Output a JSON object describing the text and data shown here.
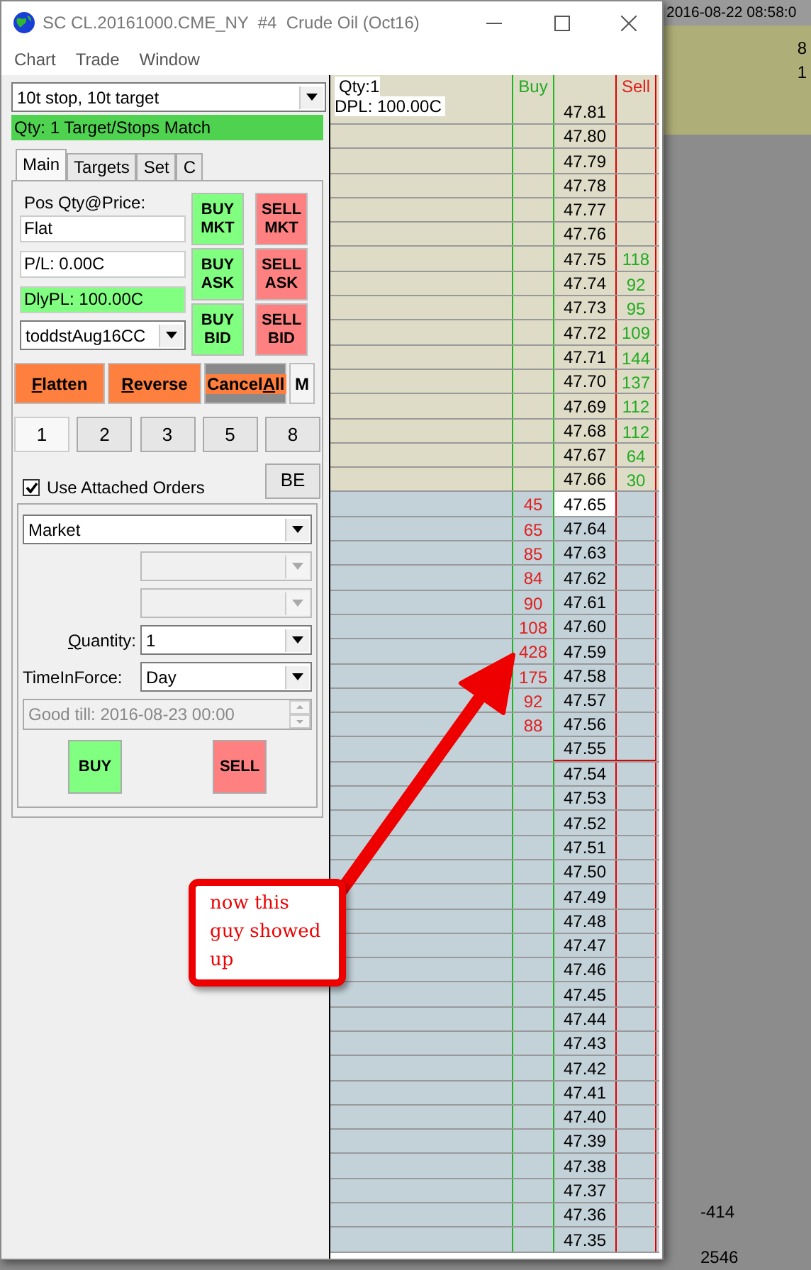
{
  "window": {
    "title": "SC CL.20161000.CME_NY  #4  Crude Oil (Oct16)"
  },
  "menu": [
    "Chart",
    "Trade",
    "Window"
  ],
  "trade_panel": {
    "preset": "10t stop, 10t target",
    "status": "Qty: 1 Target/Stops Match",
    "tabs": [
      {
        "label": "Main",
        "selected": true
      },
      {
        "label": "Targets",
        "selected": false
      },
      {
        "label": "Set",
        "selected": false
      },
      {
        "label": "C",
        "selected": false
      }
    ],
    "pos_label": "Pos Qty@Price:",
    "pos_value": "Flat",
    "pl": "P/L: 0.00C",
    "daily_pl": "DlyPL: 100.00C",
    "account": "toddstAug16CC",
    "order_buttons": [
      {
        "line1": "BUY",
        "line2": "MKT",
        "kind": "buy"
      },
      {
        "line1": "SELL",
        "line2": "MKT",
        "kind": "sell"
      },
      {
        "line1": "BUY",
        "line2": "ASK",
        "kind": "buy"
      },
      {
        "line1": "SELL",
        "line2": "ASK",
        "kind": "sell"
      },
      {
        "line1": "BUY",
        "line2": "BID",
        "kind": "buy"
      },
      {
        "line1": "SELL",
        "line2": "BID",
        "kind": "sell"
      }
    ],
    "action_buttons": [
      {
        "accel": "F",
        "after": "latten",
        "pressed": false
      },
      {
        "accel": "R",
        "after": "everse",
        "pressed": false
      },
      {
        "before": "Cancel",
        "accel": "A",
        "after": "ll",
        "pressed": true
      }
    ],
    "m_button": "M",
    "qty_buttons": [
      {
        "label": "1",
        "selected": true
      },
      {
        "label": "2",
        "selected": false
      },
      {
        "label": "3",
        "selected": false
      },
      {
        "label": "5",
        "selected": false
      },
      {
        "label": "8",
        "selected": false
      }
    ],
    "attached": {
      "label": "Use Attached Orders",
      "checked": true
    },
    "be_button": "BE",
    "order_type": "Market",
    "extra_dropdowns": [
      {
        "disabled": true
      },
      {
        "disabled": true
      }
    ],
    "quantity": {
      "accel": "Q",
      "after": "uantity:",
      "value": "1"
    },
    "time_in_force": {
      "label": "TimeInForce:",
      "value": "Day"
    },
    "good_till": {
      "value": "Good till: 2016-08-23 00:00",
      "disabled": true
    },
    "buy": "BUY",
    "sell": "SELL"
  },
  "ladder": {
    "qty": "Qty:1",
    "dpl": "DPL: 100.00C",
    "buy_header": "Buy",
    "sell_header": "Sell",
    "rows": [
      {
        "price": "47.81",
        "kind": "ask"
      },
      {
        "price": "47.80",
        "kind": "ask"
      },
      {
        "price": "47.79",
        "kind": "ask"
      },
      {
        "price": "47.78",
        "kind": "ask"
      },
      {
        "price": "47.77",
        "kind": "ask"
      },
      {
        "price": "47.76",
        "kind": "ask"
      },
      {
        "price": "47.75",
        "kind": "ask",
        "sell": "118"
      },
      {
        "price": "47.74",
        "kind": "ask",
        "sell": "92"
      },
      {
        "price": "47.73",
        "kind": "ask",
        "sell": "95"
      },
      {
        "price": "47.72",
        "kind": "ask",
        "sell": "109"
      },
      {
        "price": "47.71",
        "kind": "ask",
        "sell": "144"
      },
      {
        "price": "47.70",
        "kind": "ask",
        "sell": "137"
      },
      {
        "price": "47.69",
        "kind": "ask",
        "sell": "112"
      },
      {
        "price": "47.68",
        "kind": "ask",
        "sell": "112"
      },
      {
        "price": "47.67",
        "kind": "ask",
        "sell": "64"
      },
      {
        "price": "47.66",
        "kind": "ask",
        "sell": "30"
      },
      {
        "price": "47.65",
        "kind": "bid",
        "buy": "45",
        "last": true
      },
      {
        "price": "47.64",
        "kind": "bid",
        "buy": "65"
      },
      {
        "price": "47.63",
        "kind": "bid",
        "buy": "85"
      },
      {
        "price": "47.62",
        "kind": "bid",
        "buy": "84"
      },
      {
        "price": "47.61",
        "kind": "bid",
        "buy": "90"
      },
      {
        "price": "47.60",
        "kind": "bid",
        "buy": "108"
      },
      {
        "price": "47.59",
        "kind": "bid",
        "buy": "428"
      },
      {
        "price": "47.58",
        "kind": "bid",
        "buy": "175"
      },
      {
        "price": "47.57",
        "kind": "bid",
        "buy": "92"
      },
      {
        "price": "47.56",
        "kind": "bid",
        "buy": "88"
      },
      {
        "price": "47.55",
        "kind": "bid",
        "line_below": true
      },
      {
        "price": "47.54",
        "kind": "bid"
      },
      {
        "price": "47.53",
        "kind": "bid"
      },
      {
        "price": "47.52",
        "kind": "bid"
      },
      {
        "price": "47.51",
        "kind": "bid"
      },
      {
        "price": "47.50",
        "kind": "bid"
      },
      {
        "price": "47.49",
        "kind": "bid"
      },
      {
        "price": "47.48",
        "kind": "bid"
      },
      {
        "price": "47.47",
        "kind": "bid"
      },
      {
        "price": "47.46",
        "kind": "bid"
      },
      {
        "price": "47.45",
        "kind": "bid"
      },
      {
        "price": "47.44",
        "kind": "bid"
      },
      {
        "price": "47.43",
        "kind": "bid"
      },
      {
        "price": "47.42",
        "kind": "bid"
      },
      {
        "price": "47.41",
        "kind": "bid"
      },
      {
        "price": "47.40",
        "kind": "bid"
      },
      {
        "price": "47.39",
        "kind": "bid"
      },
      {
        "price": "47.38",
        "kind": "bid"
      },
      {
        "price": "47.37",
        "kind": "bid"
      },
      {
        "price": "47.36",
        "kind": "bid"
      },
      {
        "price": "47.35",
        "kind": "bid"
      }
    ]
  },
  "annotation": {
    "text": "now this guy showed up"
  },
  "background": {
    "timestamp": "2016-08-22 08:58:0",
    "top_values": [
      "8",
      "1"
    ],
    "bottom_values": [
      "-414",
      "2546"
    ]
  }
}
